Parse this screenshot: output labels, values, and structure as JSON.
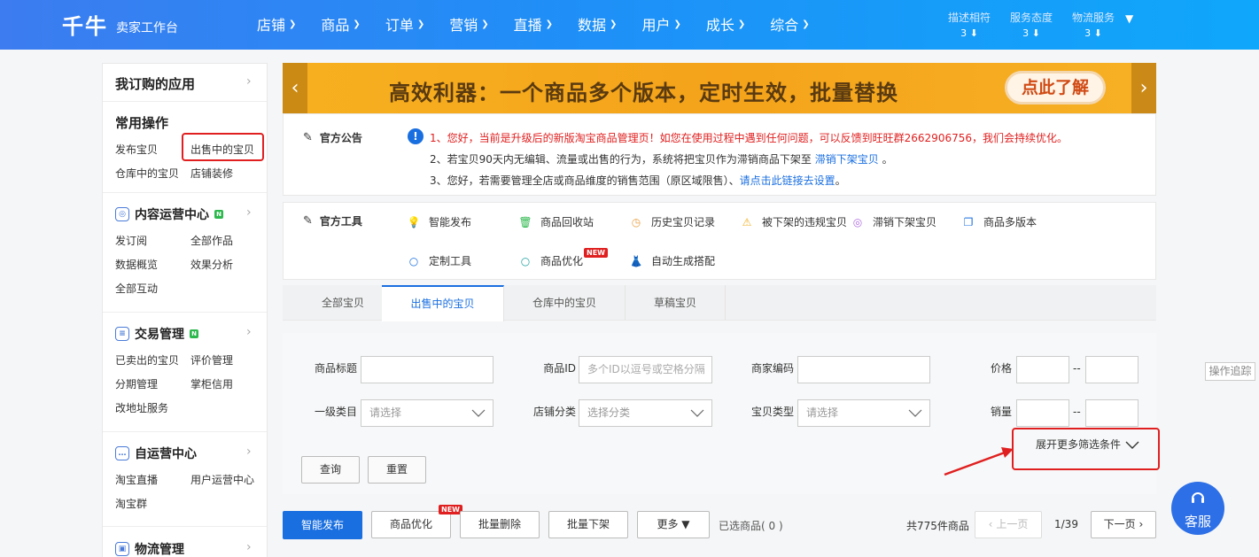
{
  "header": {
    "logo": "千牛",
    "subtitle": "卖家工作台",
    "nav": [
      "店铺",
      "商品",
      "订单",
      "营销",
      "直播",
      "数据",
      "用户",
      "成长",
      "综合"
    ],
    "ratings": [
      {
        "label": "描述相符",
        "value": "3 ⬇"
      },
      {
        "label": "服务态度",
        "value": "3 ⬇"
      },
      {
        "label": "物流服务",
        "value": "3 ⬇"
      }
    ]
  },
  "sidebar": {
    "my_apps": "我订购的应用",
    "common_ops": "常用操作",
    "common_links": [
      "发布宝贝",
      "出售中的宝贝",
      "仓库中的宝贝",
      "店铺装修"
    ],
    "content_center": "内容运营中心",
    "content_links": [
      "发订阅",
      "全部作品",
      "数据概览",
      "效果分析",
      "全部互动"
    ],
    "trade": "交易管理",
    "trade_links": [
      "已卖出的宝贝",
      "评价管理",
      "分期管理",
      "掌柜信用",
      "改地址服务"
    ],
    "self_ops": "自运营中心",
    "self_links": [
      "淘宝直播",
      "用户运营中心",
      "淘宝群"
    ],
    "logistics": "物流管理"
  },
  "banner": {
    "text": "高效利器：一个商品多个版本，定时生效，批量替换",
    "button": "点此了解"
  },
  "notice": {
    "title": "官方公告",
    "line1": "1、您好，当前是升级后的新版淘宝商品管理页！如您在使用过程中遇到任何问题，可以反馈到旺旺群2662906756，我们会持续优化。",
    "line2_pre": "2、若宝贝90天内无编辑、流量或出售的行为，系统将把宝贝作为滞销商品下架至",
    "line2_link": "滞销下架宝贝",
    "line2_post": "。",
    "line3_pre": "3、您好，若需要管理全店或商品维度的销售范围（原区域限售）、",
    "line3_link": "请点击此链接去设置",
    "line3_post": "。"
  },
  "tools": {
    "title": "官方工具",
    "items": [
      "智能发布",
      "商品回收站",
      "历史宝贝记录",
      "被下架的违规宝贝",
      "滞销下架宝贝",
      "商品多版本",
      "定制工具",
      "商品优化",
      "自动生成搭配"
    ],
    "new_badge": "NEW"
  },
  "tabs": [
    "全部宝贝",
    "出售中的宝贝",
    "仓库中的宝贝",
    "草稿宝贝"
  ],
  "filter": {
    "title_label": "商品标题",
    "id_label": "商品ID",
    "id_placeholder": "多个ID以逗号或空格分隔",
    "code_label": "商家编码",
    "price_label": "价格",
    "cat_label": "一级类目",
    "cat_placeholder": "请选择",
    "shop_cat_label": "店铺分类",
    "shop_cat_placeholder": "选择分类",
    "type_label": "宝贝类型",
    "type_placeholder": "请选择",
    "sales_label": "销量",
    "range_sep": "--",
    "expand": "展开更多筛选条件",
    "query": "查询",
    "reset": "重置"
  },
  "actions": {
    "smart_publish": "智能发布",
    "optimize": "商品优化",
    "batch_delete": "批量删除",
    "batch_offline": "批量下架",
    "more": "更多",
    "selected": "已选商品( 0 )",
    "total": "共775件商品",
    "prev": "上一页",
    "page": "1/39",
    "next": "下一页"
  },
  "side_track": "操作追踪",
  "kefu": "客服"
}
